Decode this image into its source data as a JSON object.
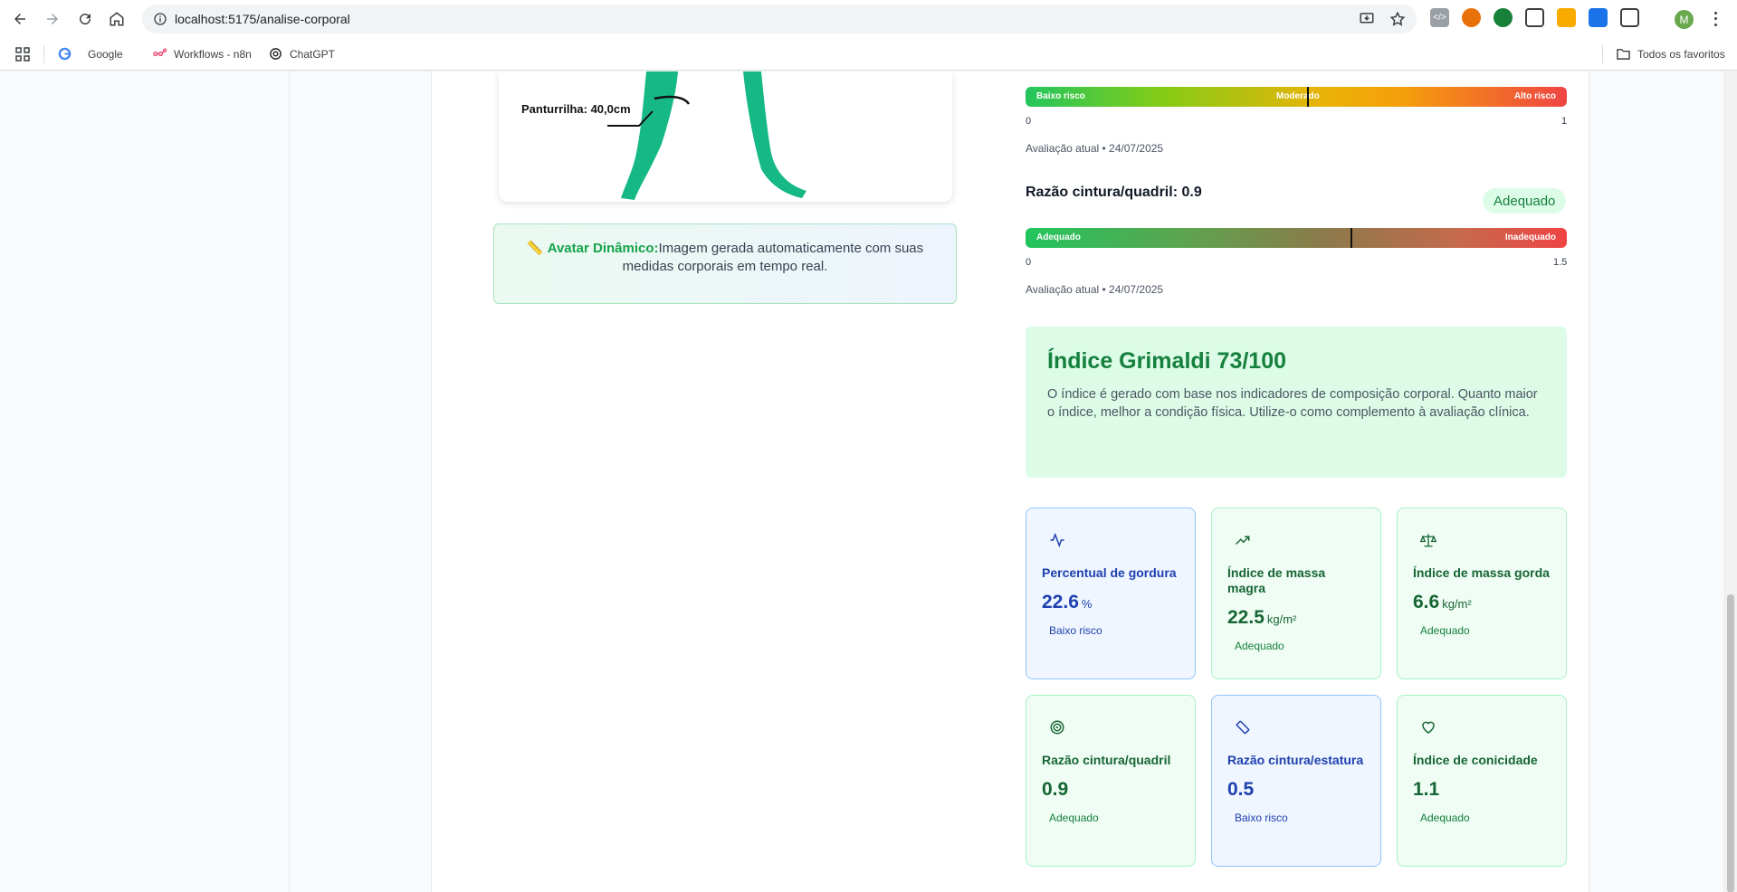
{
  "browser": {
    "url": "localhost:5175/analise-corporal",
    "bookmarks": [
      {
        "label": "Google"
      },
      {
        "label": "Workflows - n8n"
      },
      {
        "label": "ChatGPT"
      }
    ],
    "all_bookmarks_label": "Todos os favoritos",
    "profile_initial": "M"
  },
  "avatar": {
    "calf_label": "Panturrilha: 40,0cm",
    "note_strong": "Avatar Dinâmico:",
    "note_text_1": "Imagem gerada automaticamente com suas",
    "note_text_2": "medidas corporais em tempo real."
  },
  "scale_top": {
    "left_label": "Baixo risco",
    "mid_label": "Moderado",
    "right_label": "Alto risco",
    "min": "0",
    "max": "1",
    "marker_value": 0.52,
    "assessment": "Avaliação atual • 24/07/2025"
  },
  "scale_waist_hip": {
    "title": "Razão cintura/quadril: 0.9",
    "status": "Adequado",
    "left_label": "Adequado",
    "right_label": "Inadequado",
    "min": "0",
    "max": "1.5",
    "marker_value": 0.9,
    "assessment": "Avaliação atual • 24/07/2025"
  },
  "grimaldi": {
    "title": "Índice Grimaldi 73/100",
    "description": "O índice é gerado com base nos indicadores de composição corporal. Quanto maior o índice, melhor a condição física. Utilize-o como complemento à avaliação clínica."
  },
  "metrics": [
    {
      "title": "Percentual de gordura",
      "value": "22.6",
      "unit": "%",
      "status": "Baixo risco",
      "icon": "activity-icon",
      "tone": "blue"
    },
    {
      "title": "Índice de massa magra",
      "value": "22.5",
      "unit": "kg/m²",
      "status": "Adequado",
      "icon": "trending-up-icon",
      "tone": "green"
    },
    {
      "title": "Índice de massa gorda",
      "value": "6.6",
      "unit": "kg/m²",
      "status": "Adequado",
      "icon": "scale-icon",
      "tone": "green"
    },
    {
      "title": "Razão cintura/quadril",
      "value": "0.9",
      "unit": "",
      "status": "Adequado",
      "icon": "target-icon",
      "tone": "green"
    },
    {
      "title": "Razão cintura/estatura",
      "value": "0.5",
      "unit": "",
      "status": "Baixo risco",
      "icon": "ruler-icon",
      "tone": "blue"
    },
    {
      "title": "Índice de conicidade",
      "value": "1.1",
      "unit": "",
      "status": "Adequado",
      "icon": "heart-icon",
      "tone": "green"
    }
  ],
  "colors": {
    "green_bar": "#22c55e",
    "risk_gradient": [
      "#22c55e",
      "#eab308",
      "#ef4444"
    ],
    "ratio_gradient": [
      "#22c55e",
      "#8b7a4a",
      "#ef4444"
    ]
  }
}
